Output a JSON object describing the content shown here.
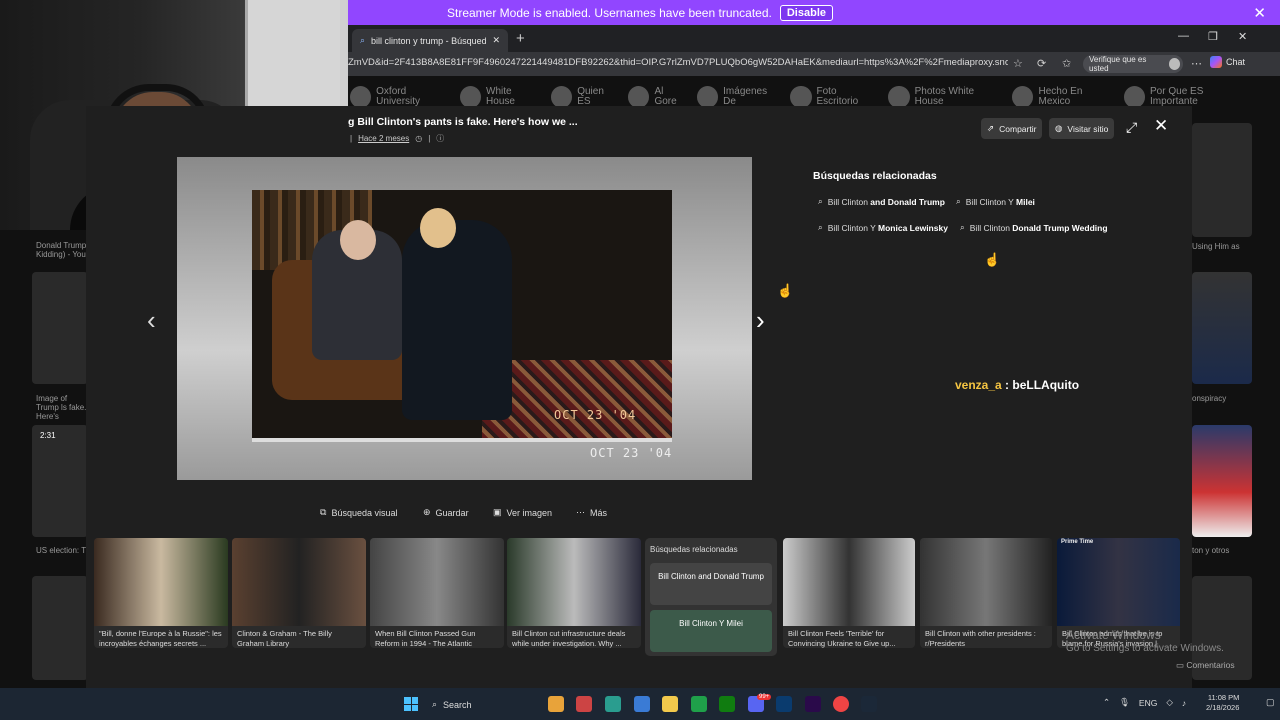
{
  "banner": {
    "text": "Streamer Mode is enabled. Usernames have been truncated.",
    "button": "Disable"
  },
  "browser": {
    "tab_title": "bill clinton y trump - Búsqueda Im...",
    "url": "ZmVD&id=2F413B8A8E81FF9F4960247221449481DFB92262&thid=OIP.G7rlZmVD7PLUQbO6gW52DAHaEK&mediaurl=https%3A%2F%2Fmediaproxy.snopes.com%...",
    "verify_label": "Verifique que es usted",
    "chat_label": "Chat"
  },
  "chips": [
    "Oxford University",
    "White House",
    "Quien ES",
    "Al Gore",
    "Imágenes De",
    "Foto Escritorio",
    "Photos White House",
    "Hecho En Mexico",
    "Por Que ES Importante"
  ],
  "background_page": {
    "left_captions": [
      "Donald Trump Kidding) - You",
      "Image of Trump ls fake. Here's",
      "US election: T"
    ],
    "left_video_time": "2:31",
    "right_captions": [
      "Using Him as",
      "onspiracy",
      "ton y otros"
    ]
  },
  "panel": {
    "title": "g Bill Clinton's pants is fake. Here's how we ...",
    "meta_time": "Hace 2 meses",
    "share": "Compartir",
    "visit": "Visitar sitio",
    "stamp_front": "OCT 23 '04",
    "stamp_back": "OCT 23 '04"
  },
  "related": {
    "heading": "Búsquedas relacionadas",
    "items": [
      {
        "pre": "Bill Clinton ",
        "bold": "and Donald Trump"
      },
      {
        "pre": "Bill Clinton Y ",
        "bold": "Milei"
      },
      {
        "pre": "Bill Clinton Y ",
        "bold": "Monica Lewinsky"
      },
      {
        "pre": "Bill Clinton ",
        "bold": "Donald Trump Wedding"
      }
    ]
  },
  "chat_message": {
    "user": "venza_a",
    "sep": " : ",
    "text": "beLLAquito"
  },
  "actions": [
    "Búsqueda visual",
    "Guardar",
    "Ver imagen",
    "Más"
  ],
  "thumbs": [
    "\"Bill, donne l'Europe à la Russie\": les incroyables échanges secrets ...",
    "Clinton & Graham - The Billy Graham Library",
    "When Bill Clinton Passed Gun Reform in 1994 - The Atlantic",
    "Bill Clinton cut infrastructure deals while under investigation. Why ...",
    "Bill Clinton Feels 'Terrible' for Convincing Ukraine to Give up...",
    "Bill Clinton with other presidents : r/Presidents",
    "Bill Clinton admits that he is to blame for Russia's invasion | Daily ..."
  ],
  "thumb_label": "Prime Time",
  "relbox": {
    "heading": "Búsquedas relacionadas",
    "a": "Bill Clinton and Donald Trump",
    "b": "Bill Clinton Y Milei"
  },
  "activate": {
    "line1": "Activate Windows",
    "line2": "Go to Settings to activate Windows."
  },
  "feedback": "Comentarios",
  "taskbar": {
    "search": "Search",
    "lang": "ENG",
    "time": "11:08 PM",
    "date": "2/18/2026",
    "badge": "99+"
  }
}
